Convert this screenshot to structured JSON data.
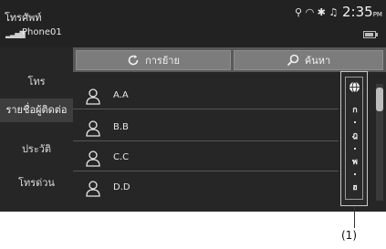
{
  "header": {
    "app_title": "โทรศัพท์",
    "phone_name": "Phone01",
    "time": "2:35",
    "ampm": "PM"
  },
  "sidebar": {
    "items": [
      {
        "label": "โทร"
      },
      {
        "label": "รายชื่อผู้ติดต่อ"
      },
      {
        "label": "ประวัติ"
      },
      {
        "label": "โทรด่วน"
      }
    ]
  },
  "toolbar": {
    "transfer_label": "การย้าย",
    "search_label": "ค้นหา"
  },
  "contacts": [
    {
      "name": "A.A"
    },
    {
      "name": "B.B"
    },
    {
      "name": "C.C"
    },
    {
      "name": "D.D"
    }
  ],
  "index_bar": {
    "letters": [
      "ก",
      "ฎ",
      "พ",
      "ฮ"
    ]
  },
  "callout": {
    "label": "(1)"
  }
}
